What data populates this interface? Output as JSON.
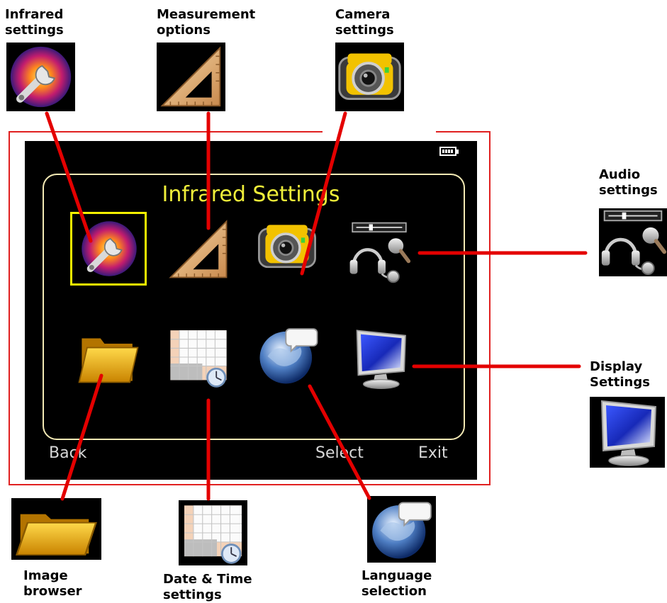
{
  "callouts": {
    "infrared_settings": "Infrared\nsettings",
    "measurement_options": "Measurement\noptions",
    "camera_settings": "Camera\nsettings",
    "audio_settings": "Audio\nsettings",
    "display_settings": "Display\nSettings",
    "image_browser": "Image\nbrowser",
    "date_time_settings": "Date & Time\nsettings",
    "language_selection": "Language\nselection"
  },
  "screen": {
    "title": "Infrared Settings",
    "softkeys": {
      "back": "Back",
      "select": "Select",
      "exit": "Exit"
    }
  },
  "colors": {
    "callout_line": "#e40000",
    "title": "#f0ef3a",
    "selection": "#f3f000",
    "panel_border": "#f3e9b4"
  },
  "icons": [
    "infrared-icon",
    "triangle-ruler-icon",
    "camera-icon",
    "headset-microphone-icon",
    "folder-icon",
    "calendar-clock-icon",
    "globe-icon",
    "monitor-icon"
  ]
}
